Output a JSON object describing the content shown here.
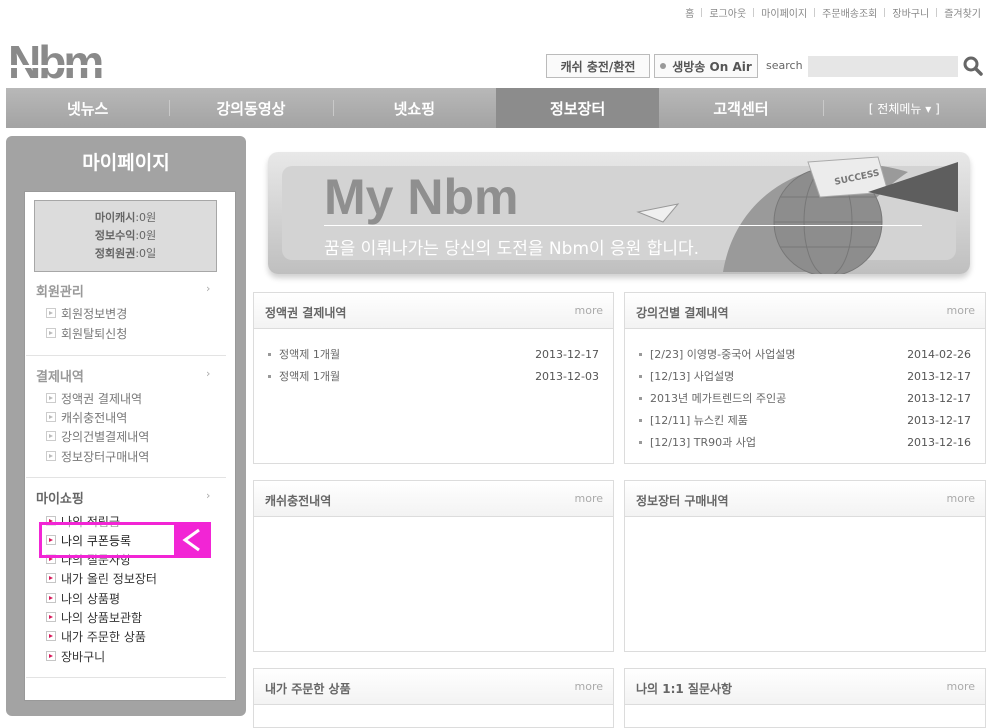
{
  "util_links": [
    "홈",
    "로그아웃",
    "마이페이지",
    "주문배송조회",
    "장바구니",
    "즐겨찾기"
  ],
  "header": {
    "logo_text": "Nbm",
    "cash_button": "캐쉬 충전/환전",
    "live_button": "생방송 On Air",
    "search_label": "search",
    "search_value": "",
    "search_icon": "magnifier-icon"
  },
  "nav": [
    "넷뉴스",
    "강의동영상",
    "넷쇼핑",
    "정보장터",
    "고객센터",
    "[ 전체메뉴 ▾ ]"
  ],
  "nav_active_index": 3,
  "sidebar": {
    "title": "마이페이지",
    "summary": [
      {
        "label": "마이캐시",
        "value": ":0원"
      },
      {
        "label": "정보수익",
        "value": ":0원"
      },
      {
        "label": "정회원권",
        "value": ":0일"
      }
    ],
    "sections": [
      {
        "title": "회원관리",
        "arrow": "›",
        "items": [
          "회원정보변경",
          "회원탈퇴신청"
        ]
      },
      {
        "title": "결제내역",
        "arrow": "›",
        "items": [
          "정액권 결제내역",
          "캐쉬충전내역",
          "강의건별결제내역",
          "정보장터구매내역"
        ]
      },
      {
        "title": "마이쇼핑",
        "arrow": "›",
        "items": [
          "나의 적립금",
          "나의 쿠폰등록",
          "나의 질문사항",
          "내가 올린 정보장터",
          "나의 상품평",
          "나의 상품보관함",
          "내가 주문한 상품",
          "장바구니"
        ]
      }
    ],
    "highlight_arrow": "<"
  },
  "banner": {
    "title": "My Nbm",
    "subtitle": "꿈을 이뤄나가는 당신의 도전을 Nbm이 응원 합니다.",
    "badge": "SUCCESS"
  },
  "panels": [
    {
      "title": "정액권 결제내역",
      "more": "more",
      "rows": [
        {
          "text": "정액제 1개월",
          "date": "2013-12-17"
        },
        {
          "text": "정액제 1개월",
          "date": "2013-12-03"
        }
      ]
    },
    {
      "title": "강의건별 결제내역",
      "more": "more",
      "rows": [
        {
          "text": "[2/23] 이영명-중국어 사업설명",
          "date": "2014-02-26"
        },
        {
          "text": "[12/13] 사업설명",
          "date": "2013-12-17"
        },
        {
          "text": "2013년 메가트렌드의 주인공",
          "date": "2013-12-17"
        },
        {
          "text": "[12/11] 뉴스킨 제품",
          "date": "2013-12-17"
        },
        {
          "text": "[12/13] TR90과 사업",
          "date": "2013-12-16"
        }
      ]
    },
    {
      "title": "캐쉬충전내역",
      "more": "more",
      "rows": []
    },
    {
      "title": "정보장터 구매내역",
      "more": "more",
      "rows": []
    },
    {
      "title": "내가 주문한 상품",
      "more": "more",
      "rows": []
    },
    {
      "title": "나의 1:1 질문사항",
      "more": "more",
      "rows": []
    }
  ]
}
